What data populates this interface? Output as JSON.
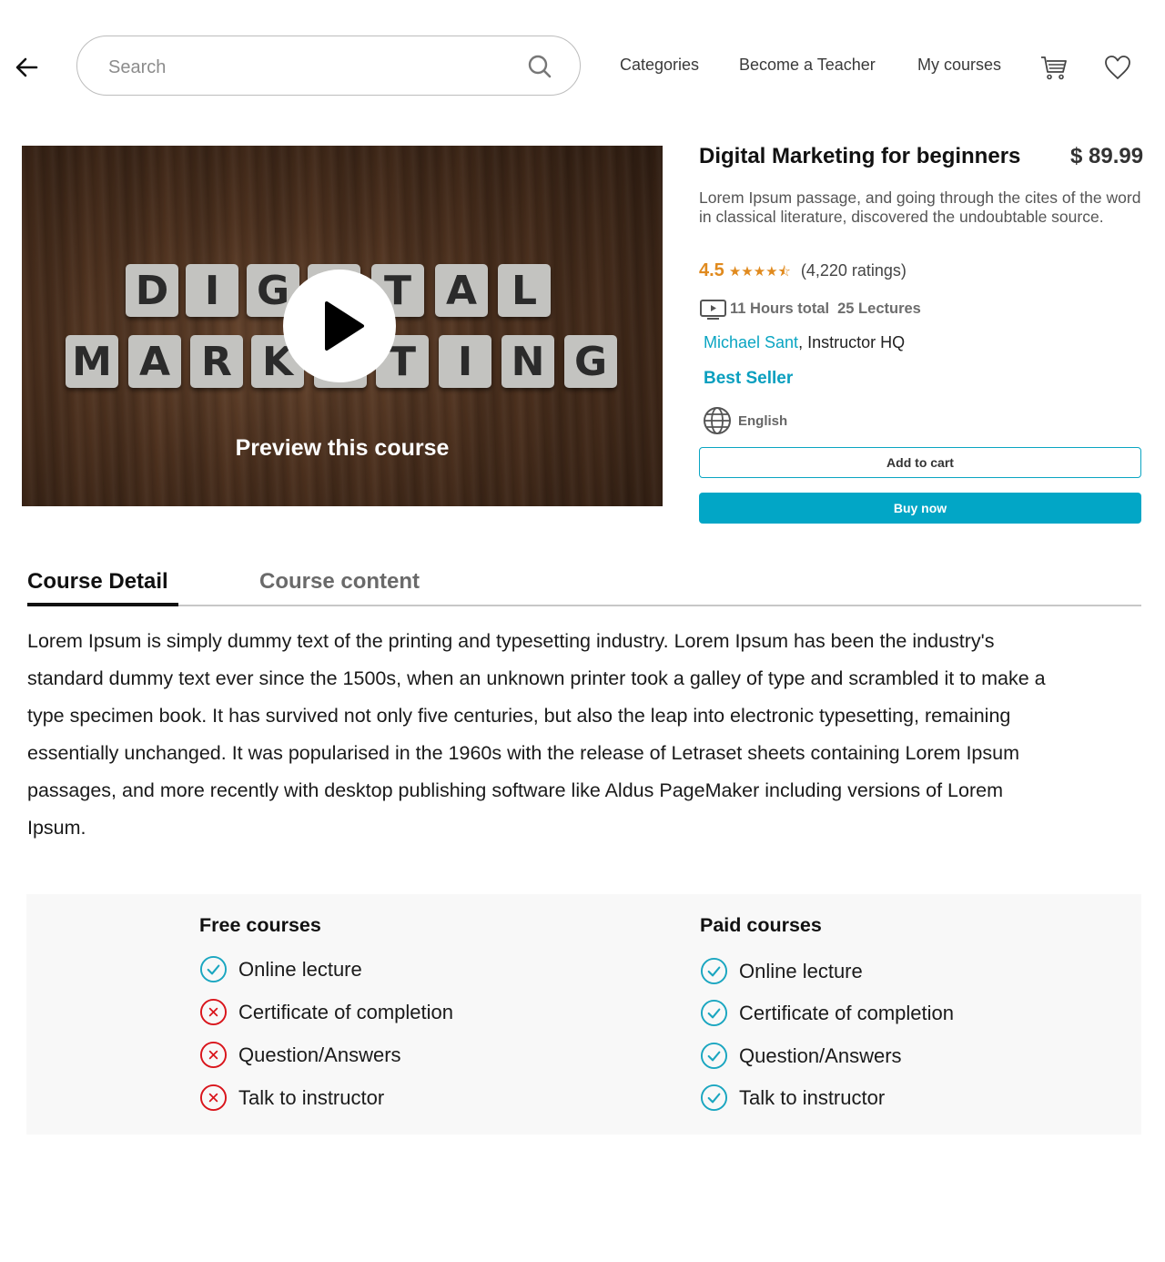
{
  "header": {
    "search_placeholder": "Search",
    "nav": [
      "Categories",
      "Become a Teacher",
      "My courses"
    ]
  },
  "preview": {
    "label": "Preview this course",
    "image_words": [
      "DIGITAL",
      "MARKETING"
    ]
  },
  "course": {
    "title": "Digital Marketing for beginners",
    "price": "$ 89.99",
    "description": "Lorem Ipsum passage, and going through the cites of the word in classical literature, discovered the undoubtable source.",
    "rating": "4.5",
    "stars": "★★★★⯪",
    "rating_count": "(4,220 ratings)",
    "hours": "11 Hours total",
    "lectures": "25 Lectures",
    "instructor_name": "Michael Sant",
    "instructor_org": ", Instructor HQ",
    "badge": "Best Seller",
    "language": "English",
    "add_to_cart": "Add to cart",
    "buy_now": "Buy now"
  },
  "tabs": [
    {
      "label": "Course Detail",
      "active": true
    },
    {
      "label": "Course content",
      "active": false
    }
  ],
  "detail_text": "Lorem Ipsum is simply dummy text of the printing and typesetting industry. Lorem Ipsum has been the industry's standard dummy text ever since the 1500s, when an unknown printer took a galley of type and scrambled it to make a type specimen book. It has survived not only five centuries, but also the leap into electronic typesetting, remaining essentially unchanged. It was popularised in the 1960s with the release of Letraset sheets containing Lorem Ipsum passages, and more recently with desktop publishing software like Aldus PageMaker including versions of Lorem Ipsum.",
  "compare": {
    "free": {
      "title": "Free courses",
      "features": [
        {
          "label": "Online lecture",
          "included": true
        },
        {
          "label": "Certificate of completion",
          "included": false
        },
        {
          "label": "Question/Answers",
          "included": false
        },
        {
          "label": "Talk to instructor",
          "included": false
        }
      ]
    },
    "paid": {
      "title": "Paid courses",
      "features": [
        {
          "label": "Online lecture",
          "included": true
        },
        {
          "label": "Certificate of completion",
          "included": true
        },
        {
          "label": "Question/Answers",
          "included": true
        },
        {
          "label": "Talk to instructor",
          "included": true
        }
      ]
    }
  },
  "colors": {
    "accent": "#02a6c6",
    "rating": "#e08a1e",
    "check": "#1aa6c0",
    "cross": "#d9141b"
  }
}
